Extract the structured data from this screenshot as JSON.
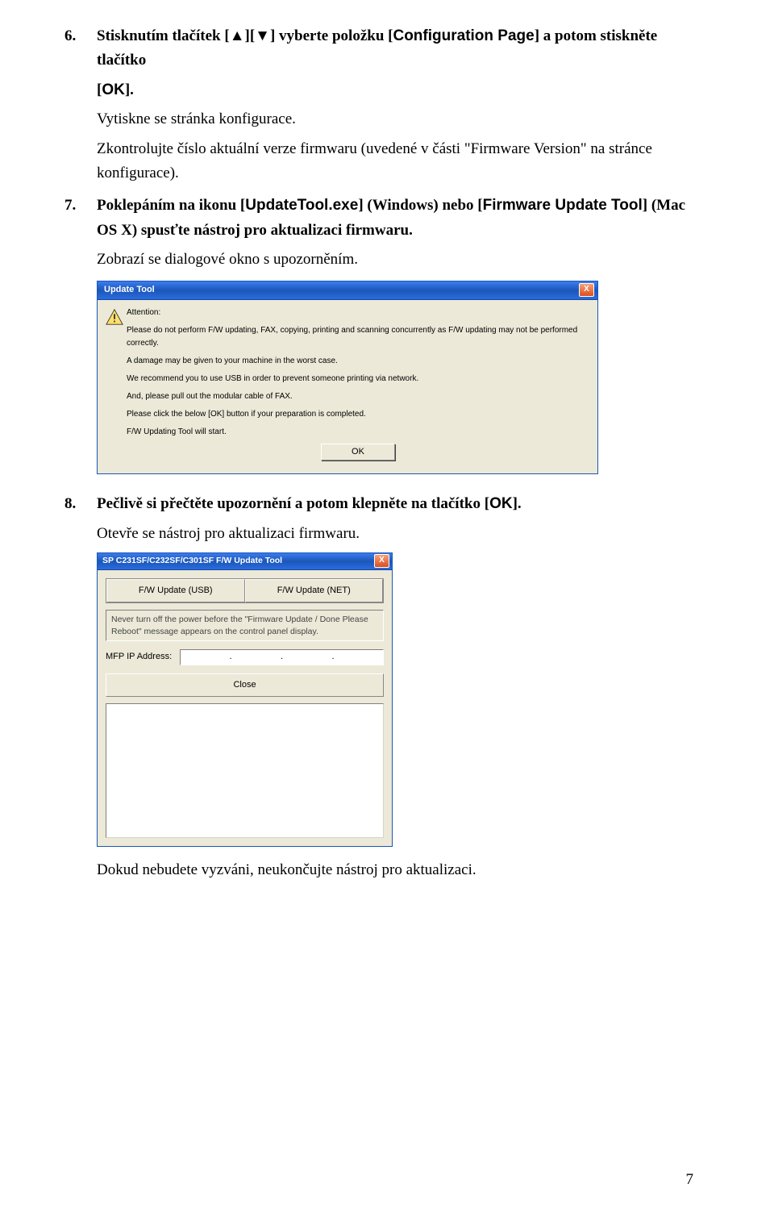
{
  "steps": {
    "s6": {
      "num": "6.",
      "line1_pre": "Stisknutím tlačítek [",
      "up": "▲",
      "mid": "][",
      "down": "▼",
      "line1_post": "] vyberte položku [",
      "conf_page": "Configuration Page",
      "line1_end": "] a potom stiskněte tlačítko",
      "line2_pre": "[",
      "ok": "OK",
      "line2_post": "].",
      "line3": "Vytiskne se stránka konfigurace.",
      "line4": "Zkontrolujte číslo aktuální verze firmwaru (uvedené v části \"Firmware Version\" na stránce konfigurace)."
    },
    "s7": {
      "num": "7.",
      "l1_pre": "Poklepáním na ikonu [",
      "exe": "UpdateTool.exe",
      "l1_mid": "] (Windows) nebo [",
      "tool": "Firmware Update Tool",
      "l1_end": "] (Mac OS X) spusťte nástroj pro aktualizaci firmwaru.",
      "l2": "Zobrazí se dialogové okno s upozorněním."
    },
    "s8": {
      "num": "8.",
      "l1_pre": "Pečlivě si přečtěte upozornění a potom klepněte na tlačítko [",
      "ok": "OK",
      "l1_post": "].",
      "l2": "Otevře se nástroj pro aktualizaci firmwaru.",
      "l3": "Dokud nebudete vyzváni, neukončujte nástroj pro aktualizaci."
    }
  },
  "dlg1": {
    "title": "Update Tool",
    "close": "X",
    "attention": "Attention:",
    "lines": [
      "Please do not perform F/W updating, FAX, copying, printing and scanning concurrently as F/W updating may not be performed correctly.",
      "A damage may be given to your machine in the worst case.",
      "We recommend you to use USB in order to prevent someone printing via network.",
      "And, please pull out the modular cable of FAX.",
      "Please click the below [OK] button if your preparation is completed.",
      "F/W Updating Tool will start."
    ],
    "ok": "OK"
  },
  "dlg2": {
    "title": "SP C231SF/C232SF/C301SF F/W Update Tool",
    "close": "X",
    "btn_usb": "F/W Update (USB)",
    "btn_net": "F/W Update (NET)",
    "msg": "Never turn off the power before the \"Firmware Update / Done Please Reboot\" message appears on the control panel display.",
    "ip_label": "MFP IP Address:",
    "dot": ".",
    "close_btn": "Close"
  },
  "page_number": "7"
}
